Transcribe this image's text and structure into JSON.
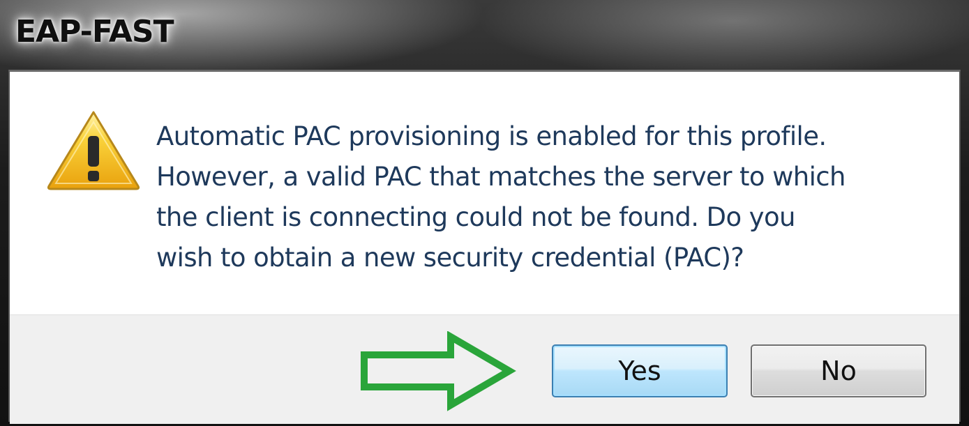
{
  "window": {
    "title": "EAP-FAST"
  },
  "dialog": {
    "icon": "warning-icon",
    "message_lines": [
      "Automatic PAC provisioning is enabled for this profile.",
      "However, a valid PAC that matches the server to which",
      "the client is connecting could not be found. Do you",
      "wish to obtain a new security credential (PAC)?"
    ]
  },
  "buttons": {
    "yes_label": "Yes",
    "no_label": "No"
  },
  "annotation": {
    "icon": "arrow-right-icon",
    "color": "#2aa53a"
  },
  "colors": {
    "message_text": "#1e395b",
    "warning_fill": "#f6c21c",
    "default_button_border": "#3c7fb1"
  }
}
